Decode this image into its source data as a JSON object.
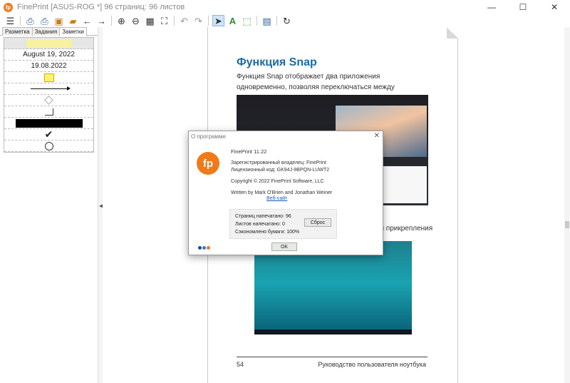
{
  "window": {
    "title": "FinePrint [ASUS-ROG *] 96 страниц: 96 листов",
    "logo_text": "fp",
    "minimize": "—",
    "maximize": "☐",
    "close": "✕"
  },
  "toolbar": {
    "icons": [
      "menu-icon",
      "print-icon",
      "print-alt-icon",
      "save-icon",
      "open-folder-icon",
      "back-arrow-icon",
      "forward-arrow-icon",
      "zoom-in-icon",
      "zoom-out-icon",
      "grid-icon",
      "fit-page-icon",
      "undo-icon",
      "redo-icon",
      "cursor-icon",
      "text-tool-icon",
      "selection-tool-icon",
      "page-setup-icon",
      "refresh-icon"
    ]
  },
  "left_panel": {
    "tabs": [
      "Разметка",
      "Задания",
      "Заметки"
    ],
    "active_tab": "Заметки",
    "notes": {
      "date_long": "August 19, 2022",
      "date_short": "19.08.2022"
    }
  },
  "page": {
    "title": "Функция Snap",
    "paragraph": "Функция Snap отображает два приложения одновременно, позволяя переключаться между ними.",
    "paragraph2": "ия прикрепления",
    "footer_page": "54",
    "footer_title": "Руководство пользователя ноутбука"
  },
  "dialog": {
    "title": "О программе",
    "close": "✕",
    "logo_text": "fp",
    "version": "FinePrint 11.22",
    "owner": "Зарегистрированный владелец:  FinePrint",
    "license": "Лицензионный код:  GK94J-9BPQN-LUWT2",
    "copyright": "Copyright © 2022 FinePrint Software, LLC",
    "authors": "Written by Mark O'Brien and Jonathan Weiner",
    "website": "Веб-сайт",
    "stats": {
      "pages_printed": "Страниц напечатано: 96",
      "sheets_printed": "Листов напечатано:   0",
      "paper_saved": "Сэкономлено бумаги: 100%"
    },
    "reset_label": "Сброс",
    "ok_label": "OK",
    "dot_colors": [
      "#1f4e8c",
      "#2b7fd0",
      "#f07a1a"
    ]
  },
  "colors": {
    "accent_orange": "#f07a1a",
    "heading_blue": "#1a6aa8",
    "link_blue": "#1a56c8"
  }
}
